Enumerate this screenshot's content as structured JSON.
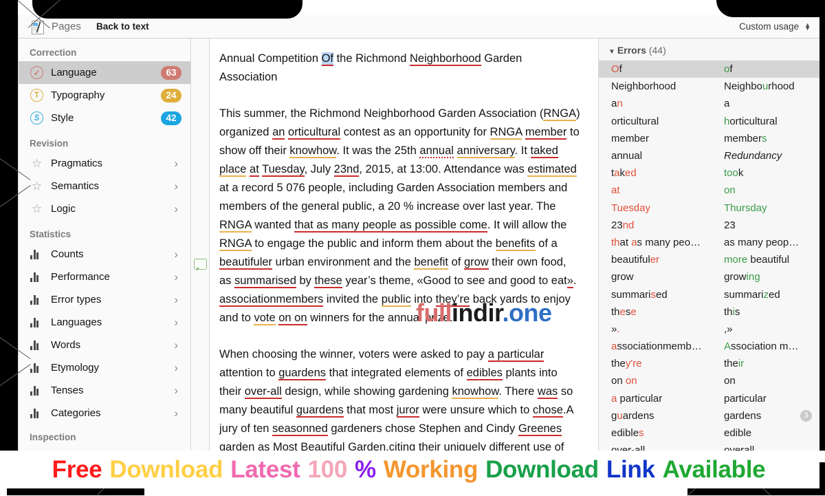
{
  "toolbar": {
    "pages_label": "Pages",
    "back_label": "Back to text",
    "custom_usage_label": "Custom usage",
    "doc_icon": "document-pen-icon",
    "stepper_icon": "up-down-stepper-icon"
  },
  "sidebar": {
    "sections": [
      {
        "title": "Correction",
        "items": [
          {
            "label": "Language",
            "icon": "check-circle-icon",
            "badge": "63",
            "badge_color": "#d07a74",
            "selected": true
          },
          {
            "label": "Typography",
            "icon": "t-circle-icon",
            "badge": "24",
            "badge_color": "#dfae3b",
            "selected": false
          },
          {
            "label": "Style",
            "icon": "s-circle-icon",
            "badge": "42",
            "badge_color": "#1ba5e0",
            "selected": false
          }
        ]
      },
      {
        "title": "Revision",
        "items": [
          {
            "label": "Pragmatics",
            "icon": "star-icon",
            "chevron": "›"
          },
          {
            "label": "Semantics",
            "icon": "star-icon",
            "chevron": "›"
          },
          {
            "label": "Logic",
            "icon": "star-icon",
            "chevron": "›"
          }
        ]
      },
      {
        "title": "Statistics",
        "items": [
          {
            "label": "Counts",
            "icon": "bar-chart-icon",
            "chevron": "›"
          },
          {
            "label": "Performance",
            "icon": "bar-chart-icon",
            "chevron": "›"
          },
          {
            "label": "Error types",
            "icon": "bar-chart-icon",
            "chevron": "›"
          },
          {
            "label": "Languages",
            "icon": "bar-chart-icon",
            "chevron": "›"
          },
          {
            "label": "Words",
            "icon": "bar-chart-icon",
            "chevron": "›"
          },
          {
            "label": "Etymology",
            "icon": "bar-chart-icon",
            "chevron": "›"
          },
          {
            "label": "Tenses",
            "icon": "bar-chart-icon",
            "chevron": "›"
          },
          {
            "label": "Categories",
            "icon": "bar-chart-icon",
            "chevron": "›"
          }
        ]
      },
      {
        "title": "Inspection",
        "items": []
      }
    ]
  },
  "gutter": {
    "comment_icon": "comment-bubble-icon"
  },
  "document": {
    "title_line1_a": "Annual Competition ",
    "title_of": "Of",
    "title_line1_b": " the Richmond ",
    "title_neighborhood": "Neighborhood",
    "title_line1_c": " Garden",
    "title_line2": "Association",
    "p2": {
      "s1": "This summer, the Richmond Neighborhood Garden Association (",
      "rnga1": "RNGA",
      "s2": ") organized ",
      "an": "an",
      "s3": " ",
      "orticultural": "orticultural",
      "s4": " contest as an opportunity for ",
      "rnga2": "RNGA",
      "s5": " ",
      "member": "member",
      "s6": " to show off their ",
      "knowhow": "knowhow",
      "s7": ". It was the 25th ",
      "annual": "annual",
      "s8": " ",
      "anniversary": "anniversary",
      "s9": ". It ",
      "taked": "taked",
      "s10": " ",
      "place": "place",
      "s11": " ",
      "at": "at",
      "s12": " ",
      "tuesday": "Tuesday",
      "s13": ", July ",
      "d23nd": "23nd",
      "s14": ", 2015, at 13:00. Attendance was ",
      "estimated": "estimated",
      "s15": " at a record 5 076 people, including Garden Association members and members of the general public, a 20 % increase over last year. The ",
      "rnga3": "RNGA",
      "s16": " wanted ",
      "thatclause": "that as many people as possible come",
      "s17": ". It will allow the ",
      "rnga4": "RNGA",
      "s18": " to engage the public and inform them about the ",
      "benefits": "benefits",
      "s19": " of a ",
      "beautifuler": "beautifuler",
      "s20": " urban environment and the ",
      "benefit": "benefit",
      "s21": " of ",
      "grow": "grow",
      "s22": " their own food, as ",
      "summarised": "summarised",
      "s23": " by ",
      "these": "these",
      "s24": " year’s theme, «Good to see and good to eat",
      "quote": "»",
      "s25": ". ",
      "associationmembers": "associationmembers",
      "s26": " invited the ",
      "public": "public",
      "s27": " into ",
      "theyre": "they’re",
      "s28": " back yards to enjoy and to ",
      "vote": "vote",
      "s29": " ",
      "onon": "on on",
      "s30": " winners for the annual prize."
    },
    "p3": {
      "s1": "When choosing the winner, voters were asked to pay ",
      "aparticular": "a particular",
      "s2": " attention to ",
      "guardens1": "guardens",
      "s3": " that integrated elements of ",
      "edibles": "edibles",
      "s4": " plants into their ",
      "overall": "over-all",
      "s5": " design, while showing gardening ",
      "knowhow": "knowhow",
      "s6": ". There ",
      "was": "was",
      "s7": " so many beautiful ",
      "guardens2": "guardens",
      "s8": " that most ",
      "juror": "juror",
      "s9": " were unsure which to ",
      "chose": "chose",
      "s10": ".A jury of ten ",
      "seasonned": "seasonned",
      "s11": " gardeners chose Stephen and Cindy ",
      "greenes": "Greenes",
      "s12": " garden as Most Beautiful Garden,citing their uniquely different use of"
    },
    "watermark": {
      "part1": "full",
      "part2": "indir",
      "part3": ".one"
    }
  },
  "errors_panel": {
    "header_label": "Errors",
    "header_count": "(44)",
    "collapse_icon": "triangle-down-icon",
    "rows": [
      {
        "selected": true,
        "error": [
          {
            "t": "O",
            "c": "r"
          },
          {
            "t": "f",
            "c": ""
          }
        ],
        "fix": [
          {
            "t": "o",
            "c": "g"
          },
          {
            "t": "f",
            "c": ""
          }
        ]
      },
      {
        "selected": false,
        "error": [
          {
            "t": "Neighborhood",
            "c": ""
          }
        ],
        "fix": [
          {
            "t": "Neighbo",
            "c": ""
          },
          {
            "t": "u",
            "c": "g"
          },
          {
            "t": "rhood",
            "c": ""
          }
        ]
      },
      {
        "selected": false,
        "error": [
          {
            "t": "a",
            "c": ""
          },
          {
            "t": "n",
            "c": "r"
          }
        ],
        "fix": [
          {
            "t": "a",
            "c": ""
          }
        ]
      },
      {
        "selected": false,
        "error": [
          {
            "t": "orticultural",
            "c": ""
          }
        ],
        "fix": [
          {
            "t": "h",
            "c": "g"
          },
          {
            "t": "orticultural",
            "c": ""
          }
        ]
      },
      {
        "selected": false,
        "error": [
          {
            "t": "member",
            "c": ""
          }
        ],
        "fix": [
          {
            "t": "member",
            "c": ""
          },
          {
            "t": "s",
            "c": "g"
          }
        ]
      },
      {
        "selected": false,
        "error": [
          {
            "t": "annual",
            "c": ""
          }
        ],
        "fix": [
          {
            "t": "Redundancy",
            "c": "i"
          }
        ]
      },
      {
        "selected": false,
        "error": [
          {
            "t": "t",
            "c": ""
          },
          {
            "t": "a",
            "c": "r"
          },
          {
            "t": "k",
            "c": ""
          },
          {
            "t": "ed",
            "c": "r"
          }
        ],
        "fix": [
          {
            "t": "t",
            "c": "g"
          },
          {
            "t": "oo",
            "c": "g"
          },
          {
            "t": "k",
            "c": ""
          }
        ]
      },
      {
        "selected": false,
        "error": [
          {
            "t": "at",
            "c": "r"
          }
        ],
        "fix": [
          {
            "t": "on",
            "c": "g"
          }
        ]
      },
      {
        "selected": false,
        "error": [
          {
            "t": "Tuesday",
            "c": "r"
          }
        ],
        "fix": [
          {
            "t": "Thursday",
            "c": "g"
          }
        ]
      },
      {
        "selected": false,
        "error": [
          {
            "t": "23",
            "c": ""
          },
          {
            "t": "nd",
            "c": "r"
          }
        ],
        "fix": [
          {
            "t": "23",
            "c": ""
          }
        ]
      },
      {
        "selected": false,
        "error": [
          {
            "t": "th",
            "c": "r"
          },
          {
            "t": "at ",
            "c": ""
          },
          {
            "t": "a",
            "c": "r"
          },
          {
            "t": "s many peo…",
            "c": ""
          }
        ],
        "fix": [
          {
            "t": "as many peop…",
            "c": ""
          }
        ]
      },
      {
        "selected": false,
        "error": [
          {
            "t": "beautiful",
            "c": ""
          },
          {
            "t": "er",
            "c": "r"
          }
        ],
        "fix": [
          {
            "t": "more",
            "c": "g"
          },
          {
            "t": " beautiful",
            "c": ""
          }
        ]
      },
      {
        "selected": false,
        "error": [
          {
            "t": "grow",
            "c": ""
          }
        ],
        "fix": [
          {
            "t": "grow",
            "c": ""
          },
          {
            "t": "ing",
            "c": "g"
          }
        ]
      },
      {
        "selected": false,
        "error": [
          {
            "t": "summari",
            "c": ""
          },
          {
            "t": "s",
            "c": "r"
          },
          {
            "t": "ed",
            "c": ""
          }
        ],
        "fix": [
          {
            "t": "summari",
            "c": ""
          },
          {
            "t": "z",
            "c": "g"
          },
          {
            "t": "ed",
            "c": ""
          }
        ]
      },
      {
        "selected": false,
        "error": [
          {
            "t": "th",
            "c": ""
          },
          {
            "t": "e",
            "c": "r"
          },
          {
            "t": "s",
            "c": ""
          },
          {
            "t": "e",
            "c": "r"
          }
        ],
        "fix": [
          {
            "t": "th",
            "c": ""
          },
          {
            "t": "i",
            "c": "g"
          },
          {
            "t": "s",
            "c": ""
          }
        ]
      },
      {
        "selected": false,
        "error": [
          {
            "t": "»",
            "c": ""
          },
          {
            "t": ".",
            "c": "r"
          }
        ],
        "fix": [
          {
            "t": ",",
            "c": ""
          },
          {
            "t": "»",
            "c": ""
          }
        ]
      },
      {
        "selected": false,
        "error": [
          {
            "t": "a",
            "c": "r"
          },
          {
            "t": "ssociationmemb…",
            "c": ""
          }
        ],
        "fix": [
          {
            "t": "A",
            "c": "g"
          },
          {
            "t": "ssociation m…",
            "c": ""
          }
        ]
      },
      {
        "selected": false,
        "error": [
          {
            "t": "the",
            "c": ""
          },
          {
            "t": "y",
            "c": "r"
          },
          {
            "t": "'",
            "c": "r"
          },
          {
            "t": "re",
            "c": "r"
          }
        ],
        "fix": [
          {
            "t": "the",
            "c": ""
          },
          {
            "t": "ir",
            "c": "g"
          }
        ]
      },
      {
        "selected": false,
        "error": [
          {
            "t": "on ",
            "c": ""
          },
          {
            "t": "on",
            "c": "r"
          }
        ],
        "fix": [
          {
            "t": "on",
            "c": ""
          }
        ]
      },
      {
        "selected": false,
        "error": [
          {
            "t": "a",
            "c": "r"
          },
          {
            "t": " particular",
            "c": ""
          }
        ],
        "fix": [
          {
            "t": "particular",
            "c": ""
          }
        ]
      },
      {
        "selected": false,
        "error": [
          {
            "t": "g",
            "c": ""
          },
          {
            "t": "u",
            "c": "r"
          },
          {
            "t": "ardens",
            "c": ""
          }
        ],
        "fix": [
          {
            "t": "gardens",
            "c": ""
          }
        ],
        "count": "3"
      },
      {
        "selected": false,
        "error": [
          {
            "t": "edible",
            "c": ""
          },
          {
            "t": "s",
            "c": "r"
          }
        ],
        "fix": [
          {
            "t": "edible",
            "c": ""
          }
        ]
      },
      {
        "selected": false,
        "error": [
          {
            "t": "over-all",
            "c": ""
          }
        ],
        "fix": [
          {
            "t": "overall",
            "c": ""
          }
        ]
      }
    ]
  },
  "banner": {
    "words": [
      {
        "text": "Free",
        "color": "#ff1a1a"
      },
      {
        "text": "Download",
        "color": "#ffcf45"
      },
      {
        "text": "Latest",
        "color": "#f06ab0"
      },
      {
        "text": "100",
        "color": "#f4a6b8"
      },
      {
        "text": "%",
        "color": "#8a1ff0"
      },
      {
        "text": "Working",
        "color": "#f5962f"
      },
      {
        "text": "Download",
        "color": "#18a04a"
      },
      {
        "text": "Link",
        "color": "#1136c9"
      },
      {
        "text": "Available",
        "color": "#1fa832"
      }
    ]
  }
}
